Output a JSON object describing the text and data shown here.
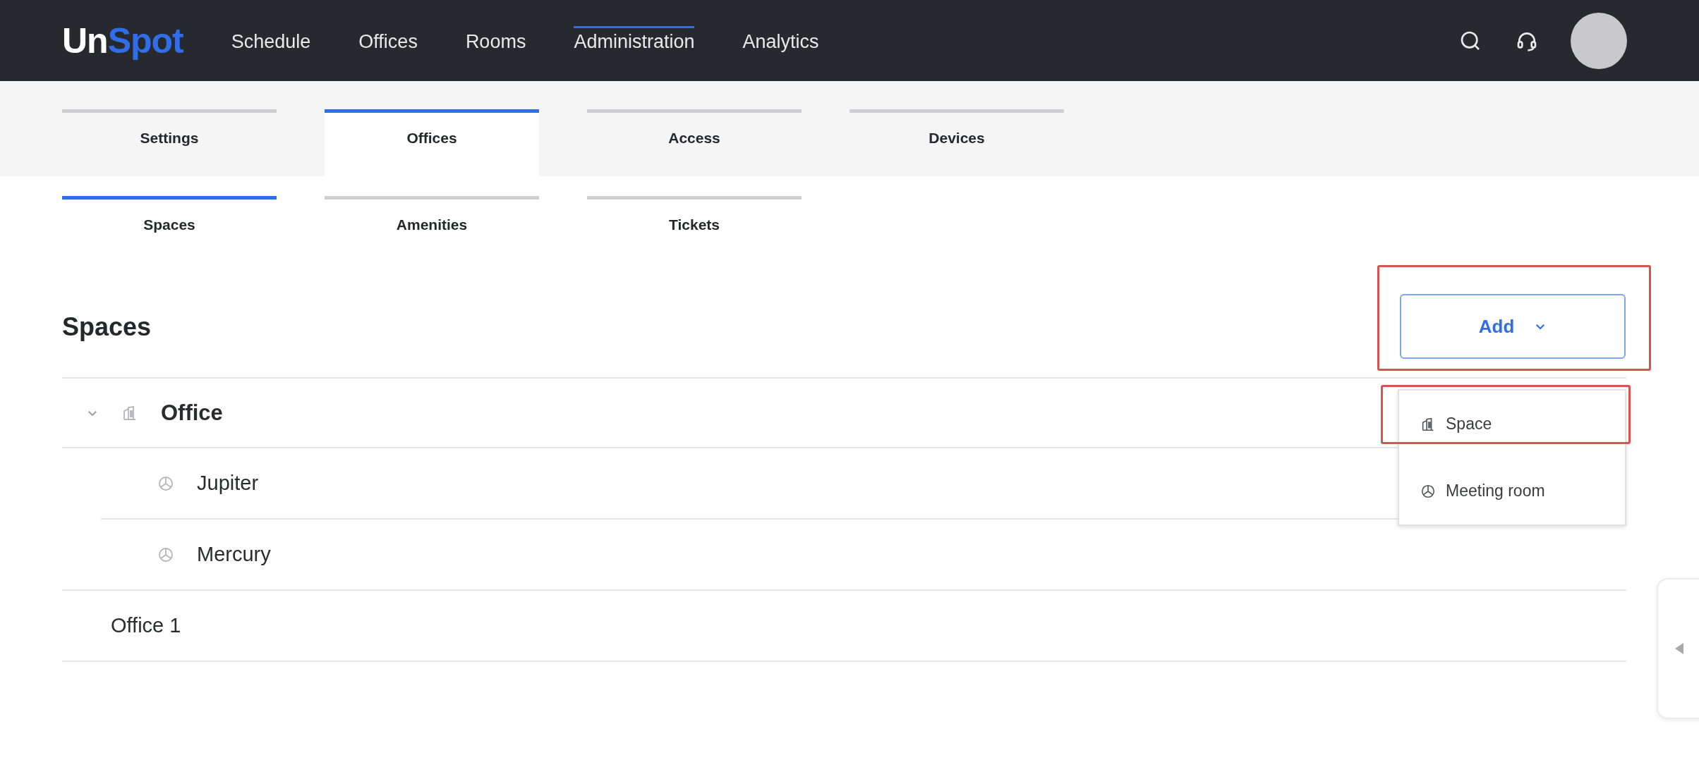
{
  "logo": {
    "first": "Un",
    "second": "Spot"
  },
  "nav": [
    {
      "label": "Schedule",
      "selected": false
    },
    {
      "label": "Offices",
      "selected": false
    },
    {
      "label": "Rooms",
      "selected": false
    },
    {
      "label": "Administration",
      "selected": true
    },
    {
      "label": "Analytics",
      "selected": false
    }
  ],
  "tabs": [
    {
      "label": "Settings",
      "selected": false
    },
    {
      "label": "Offices",
      "selected": true
    },
    {
      "label": "Access",
      "selected": false
    },
    {
      "label": "Devices",
      "selected": false
    }
  ],
  "subtabs": [
    {
      "label": "Spaces",
      "selected": true
    },
    {
      "label": "Amenities",
      "selected": false
    },
    {
      "label": "Tickets",
      "selected": false
    }
  ],
  "page_title": "Spaces",
  "add_button": {
    "label": "Add",
    "highlighted": true,
    "expanded": true
  },
  "add_menu": [
    {
      "kind": "space",
      "label": "Space",
      "highlighted": true
    },
    {
      "kind": "room",
      "label": "Meeting room",
      "highlighted": false
    }
  ],
  "tree": [
    {
      "label": "Office",
      "expanded": true,
      "children": [
        {
          "label": "Jupiter"
        },
        {
          "label": "Mercury"
        }
      ]
    },
    {
      "label": "Office 1",
      "expanded": false
    }
  ]
}
